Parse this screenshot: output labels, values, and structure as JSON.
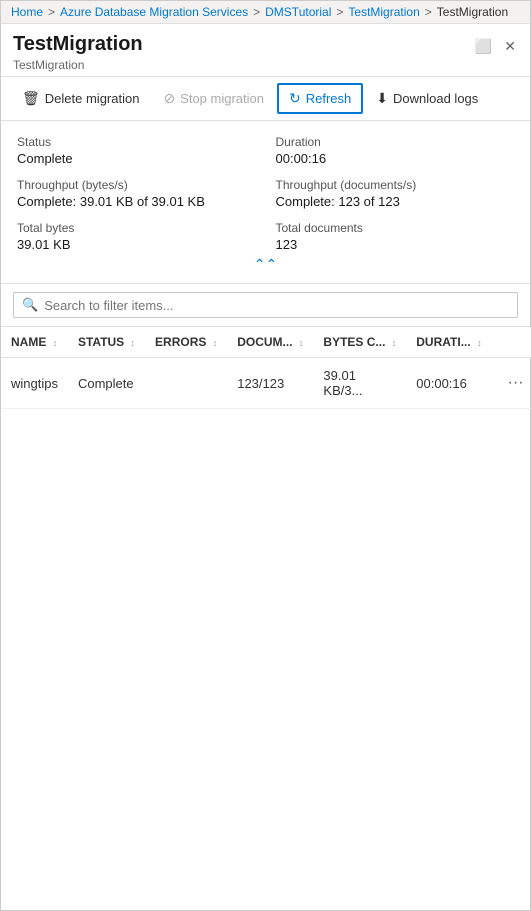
{
  "breadcrumb": {
    "items": [
      {
        "label": "Home",
        "active": true
      },
      {
        "label": "Azure Database Migration Services",
        "active": true
      },
      {
        "label": "DMSTutorial",
        "active": true
      },
      {
        "label": "TestMigration",
        "active": true
      },
      {
        "label": "TestMigration",
        "active": false
      }
    ],
    "separator": ">"
  },
  "header": {
    "title": "TestMigration",
    "subtitle": "TestMigration",
    "icons": {
      "maximize": "⬜",
      "close": "✕"
    }
  },
  "toolbar": {
    "delete_label": "Delete migration",
    "stop_label": "Stop migration",
    "refresh_label": "Refresh",
    "download_label": "Download logs"
  },
  "info": {
    "status_label": "Status",
    "status_value": "Complete",
    "duration_label": "Duration",
    "duration_value": "00:00:16",
    "throughput_bytes_label": "Throughput (bytes/s)",
    "throughput_bytes_value": "Complete: 39.01 KB of 39.01 KB",
    "throughput_docs_label": "Throughput (documents/s)",
    "throughput_docs_value": "Complete: 123 of 123",
    "total_bytes_label": "Total bytes",
    "total_bytes_value": "39.01 KB",
    "total_docs_label": "Total documents",
    "total_docs_value": "123"
  },
  "search": {
    "placeholder": "Search to filter items..."
  },
  "table": {
    "columns": [
      {
        "key": "name",
        "label": "NAME"
      },
      {
        "key": "status",
        "label": "STATUS"
      },
      {
        "key": "errors",
        "label": "ERRORS"
      },
      {
        "key": "documents",
        "label": "DOCUM..."
      },
      {
        "key": "bytes",
        "label": "BYTES C..."
      },
      {
        "key": "duration",
        "label": "DURATI..."
      }
    ],
    "rows": [
      {
        "name": "wingtips",
        "status": "Complete",
        "errors": "",
        "documents": "123/123",
        "bytes": "39.01 KB/3...",
        "duration": "00:00:16"
      }
    ]
  }
}
